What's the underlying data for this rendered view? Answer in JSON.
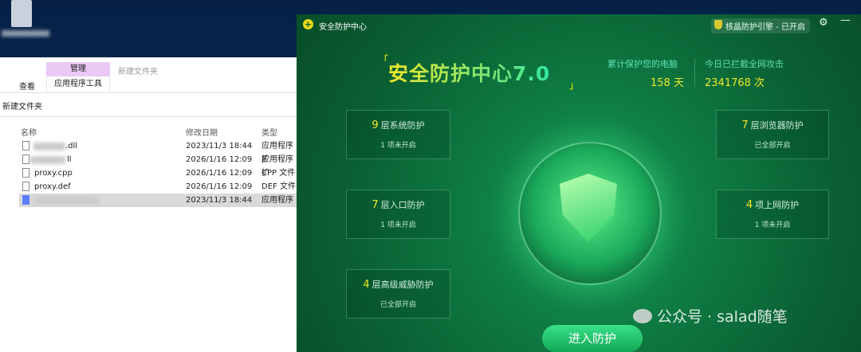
{
  "explorer": {
    "ribbon": {
      "manage_tab": "管理",
      "app_tools_tab": "应用程序工具",
      "view_tab": "查看",
      "window_title": "新建文件夹"
    },
    "address": "新建文件夹",
    "columns": {
      "name": "名称",
      "date": "修改日期",
      "type": "类型"
    },
    "files": [
      {
        "name": ".dll",
        "date": "2023/11/3 18:44",
        "type": "应用程序扩"
      },
      {
        "name": "ll",
        "date": "2026/1/16 12:09",
        "type": "应用程序扩"
      },
      {
        "name": "proxy.cpp",
        "date": "2026/1/16 12:09",
        "type": "CPP 文件"
      },
      {
        "name": "proxy.def",
        "date": "2026/1/16 12:09",
        "type": "DEF 文件"
      },
      {
        "name": "",
        "date": "2023/11/3 18:44",
        "type": "应用程序"
      }
    ]
  },
  "app": {
    "title": "安全防护中心",
    "engine": "核晶防护引擎 - 已开启",
    "headline": "安全防护中心7.0",
    "stat1": {
      "label": "累计保护您的电脑",
      "value": "158",
      "unit": "天"
    },
    "stat2": {
      "label": "今日已拦截全网攻击",
      "value": "2341768",
      "unit": "次"
    },
    "cards": [
      {
        "num": "9",
        "title": "层系统防护",
        "status": "1 项未开启"
      },
      {
        "num": "7",
        "title": "层入口防护",
        "status": "1 项未开启"
      },
      {
        "num": "4",
        "title": "层高级威胁防护",
        "status": "已全部开启"
      },
      {
        "num": "7",
        "title": "层浏览器防护",
        "status": "已全部开启"
      },
      {
        "num": "4",
        "title": "项上网防护",
        "status": "1 项未开启"
      }
    ],
    "enter_button": "进入防护"
  },
  "watermark": "公众号 · salad随笔"
}
